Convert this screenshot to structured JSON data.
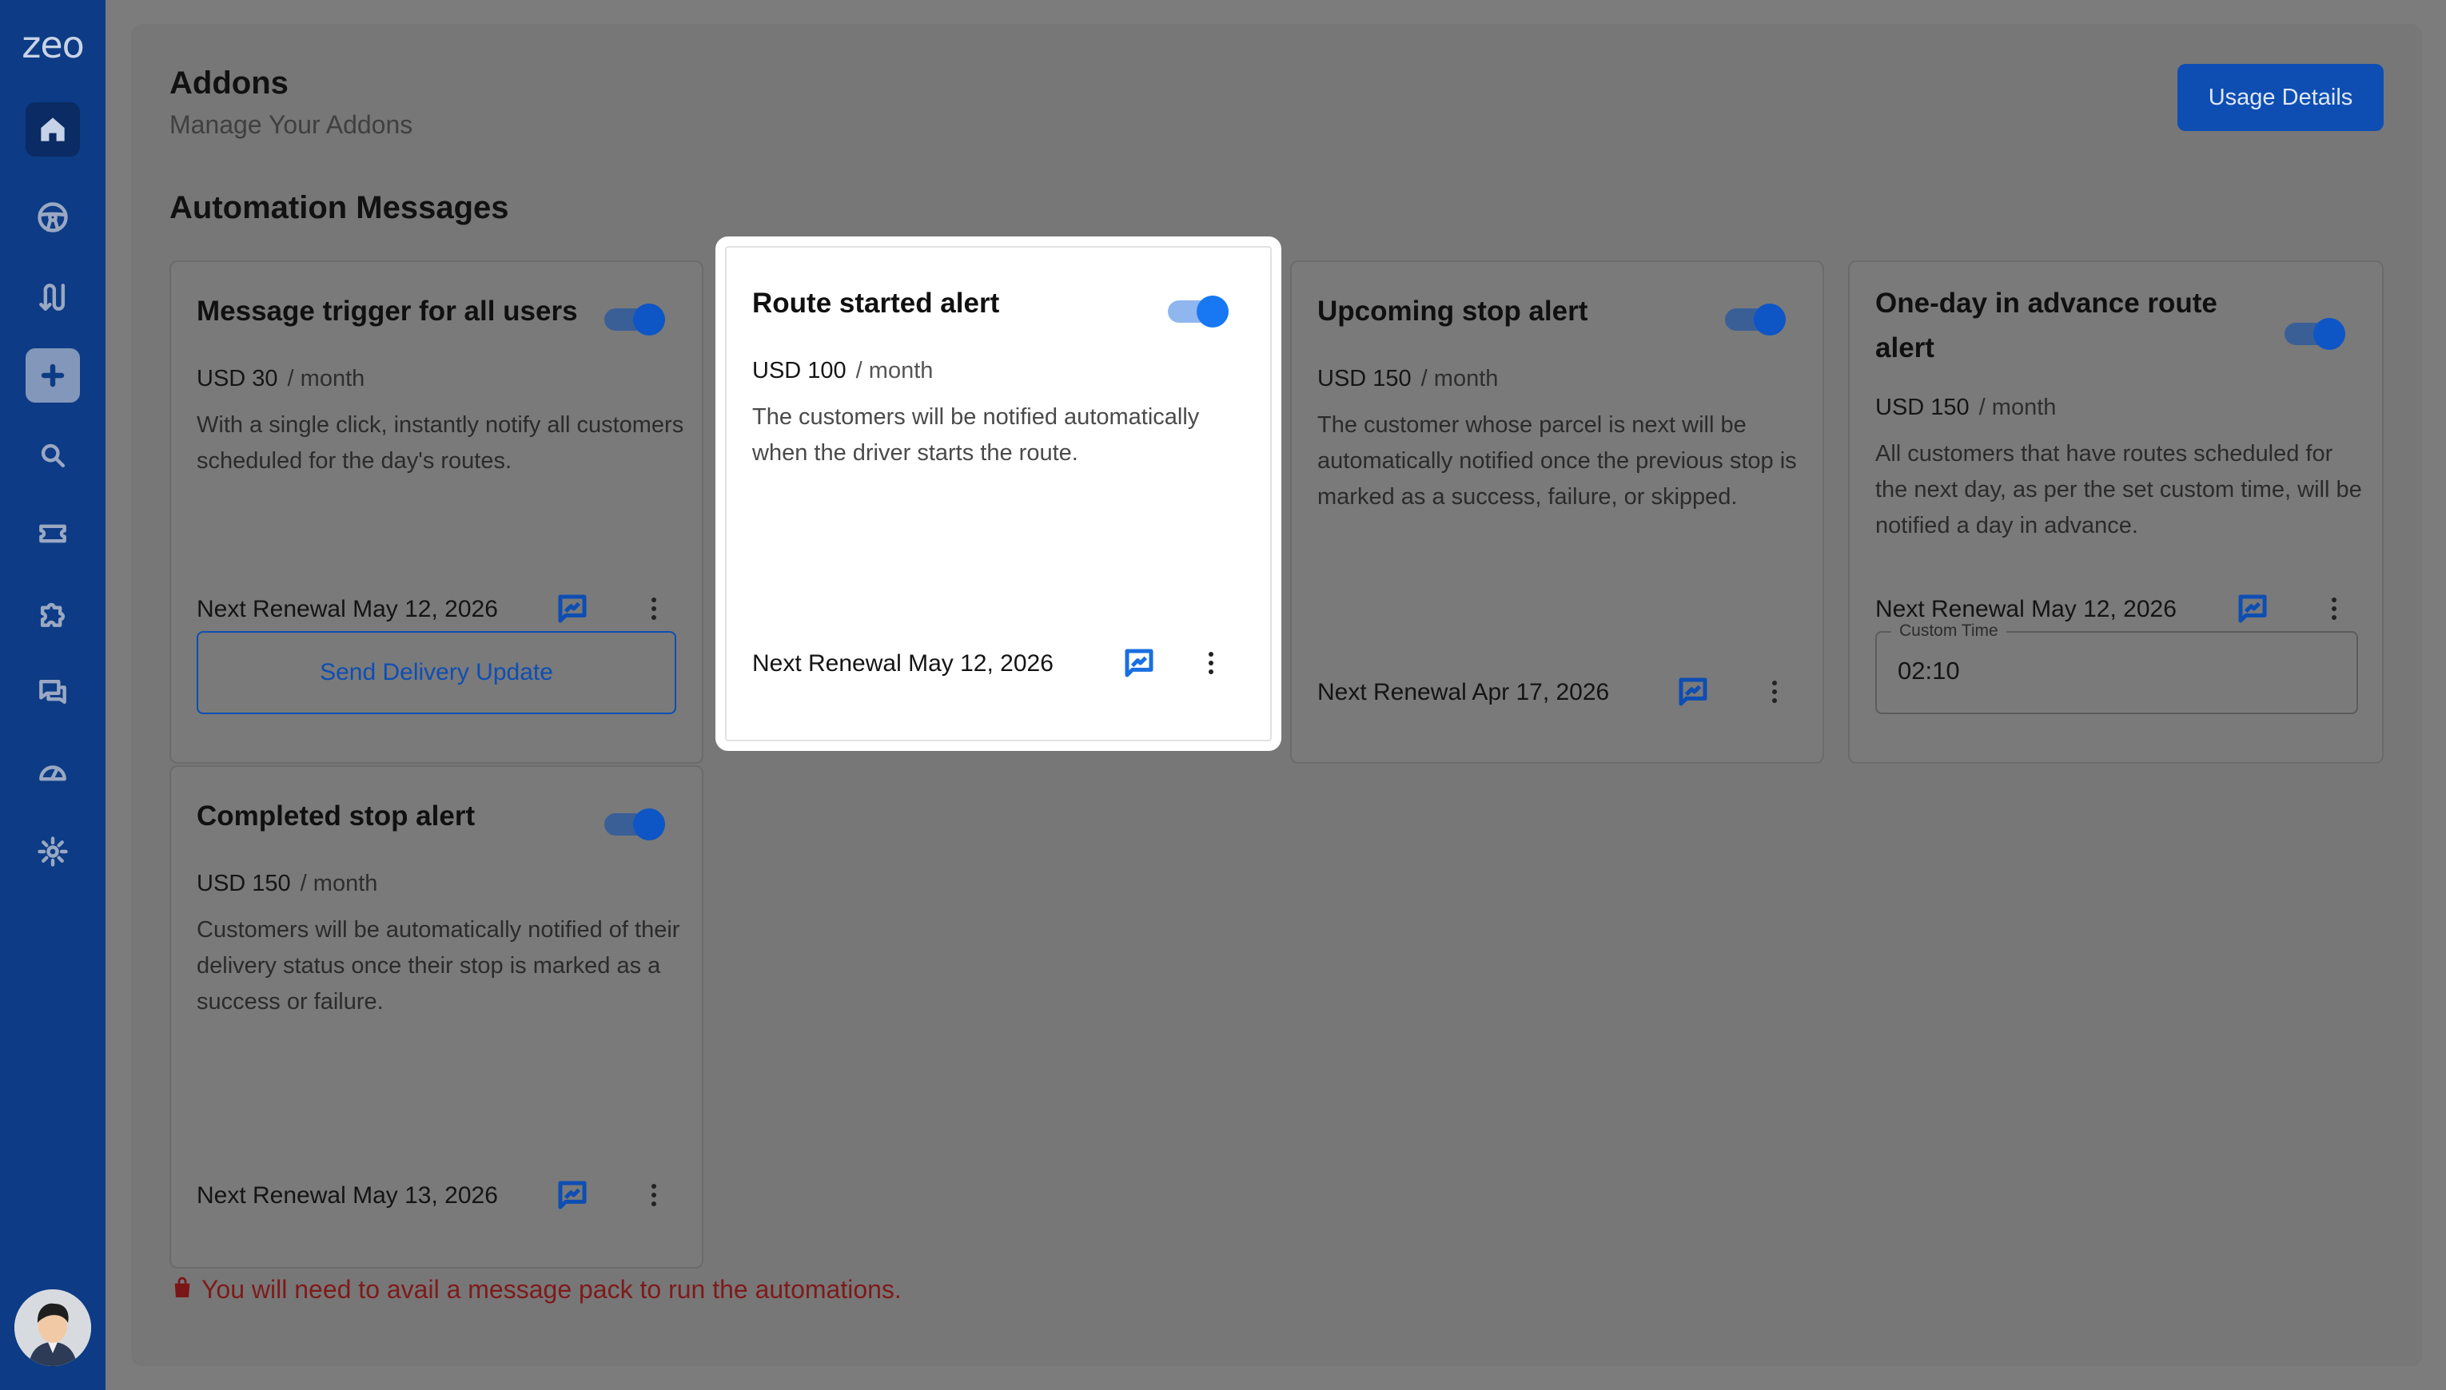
{
  "sidebar": {
    "logo": "zeo",
    "items": [
      {
        "name": "home-icon"
      },
      {
        "name": "steering-wheel-icon"
      },
      {
        "name": "routes-icon"
      },
      {
        "name": "add-icon"
      },
      {
        "name": "search-icon"
      },
      {
        "name": "ticket-icon"
      },
      {
        "name": "puzzle-icon"
      },
      {
        "name": "chat-icon"
      },
      {
        "name": "dashboard-icon"
      },
      {
        "name": "gear-icon"
      }
    ]
  },
  "header": {
    "title": "Addons",
    "subtitle": "Manage Your Addons",
    "usage_button": "Usage Details"
  },
  "section": {
    "title": "Automation Messages"
  },
  "cards": [
    {
      "title": "Message trigger for all users",
      "price": "USD 30",
      "period": "/ month",
      "description": "With a single click, instantly notify all customers scheduled for the day's routes.",
      "renewal": "Next Renewal May 12, 2026",
      "enabled": true,
      "action_button": "Send Delivery Update"
    },
    {
      "title": "Route started alert",
      "price": "USD 100",
      "period": "/ month",
      "description": "The customers will be notified automatically when the driver starts the route.",
      "renewal": "Next Renewal May 12, 2026",
      "enabled": true
    },
    {
      "title": "Upcoming stop alert",
      "price": "USD 150",
      "period": "/ month",
      "description": "The customer whose parcel is next will be automatically notified once the previous stop is marked as a success, failure, or skipped.",
      "renewal": "Next Renewal Apr 17, 2026",
      "enabled": true
    },
    {
      "title": "One-day in advance route alert",
      "price": "USD 150",
      "period": "/ month",
      "description": "All customers that have routes scheduled for the next day, as per the set custom time, will be notified a day in advance.",
      "renewal": "Next Renewal May 12, 2026",
      "enabled": true,
      "custom_time_label": "Custom Time",
      "custom_time_value": "02:10"
    },
    {
      "title": "Completed stop alert",
      "price": "USD 150",
      "period": "/ month",
      "description": "Customers will be automatically notified of their delivery status once their stop is marked as a success or failure.",
      "renewal": "Next Renewal May 13, 2026",
      "enabled": true
    }
  ],
  "warning": {
    "text": "You will need to avail a message pack to run the automations.",
    "color": "#7e1a1a"
  },
  "colors": {
    "sidebar": "#0d3b85",
    "accent": "#0e4eb3",
    "toggle_on": "#1877f2"
  }
}
